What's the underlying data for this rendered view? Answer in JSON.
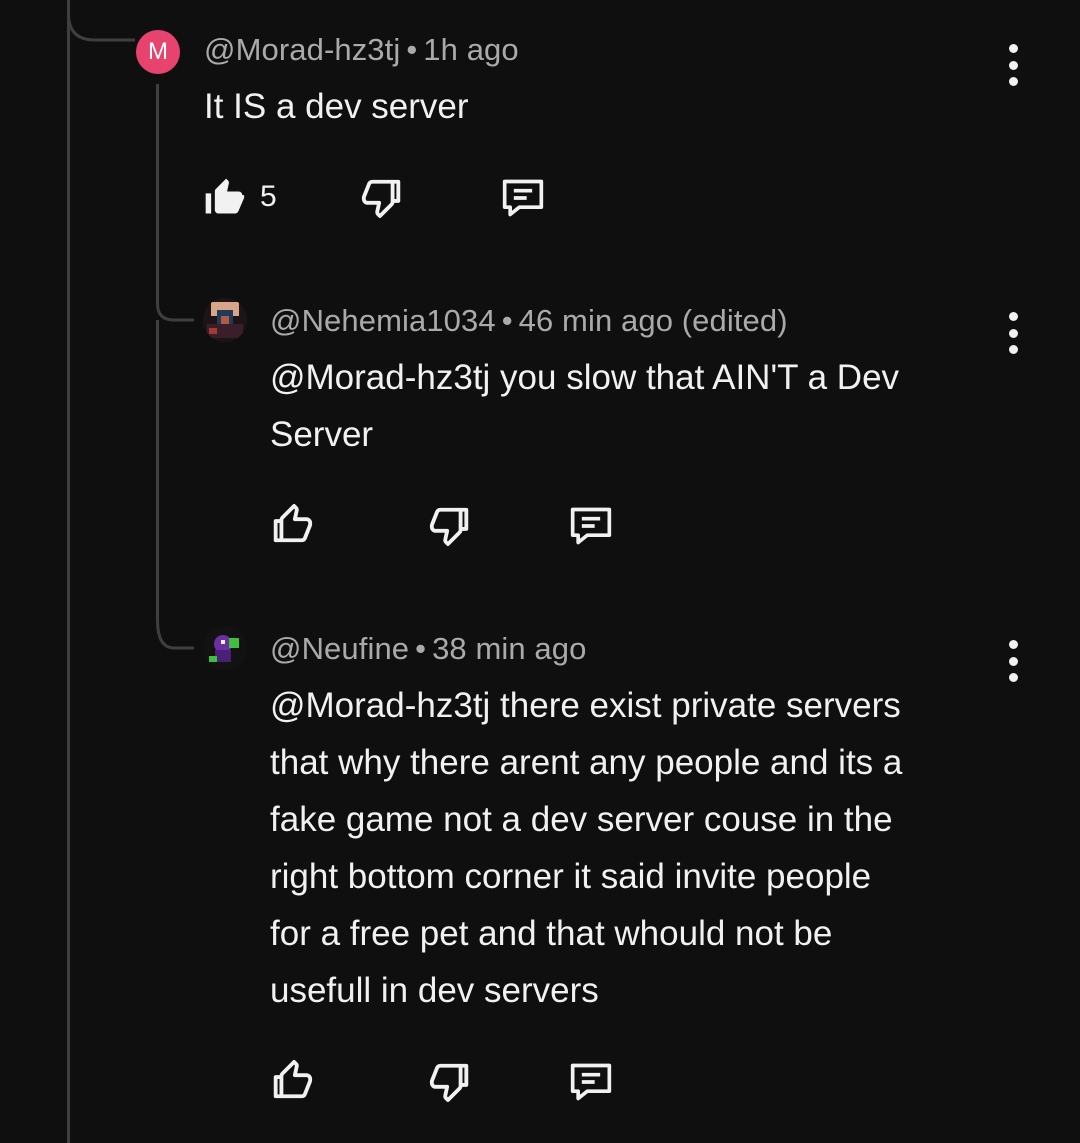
{
  "comments": [
    {
      "avatar_letter": "M",
      "author": "@Morad-hz3tj",
      "separator": "•",
      "time": "1h ago",
      "text": "It IS a dev server",
      "likes": "5"
    },
    {
      "author": "@Nehemia1034",
      "separator": "•",
      "time": "46 min ago (edited)",
      "text": "@Morad-hz3tj you slow that AIN'T a Dev\nServer"
    },
    {
      "author": "@Neufine",
      "separator": "•",
      "time": "38 min ago",
      "text": "@Morad-hz3tj there exist private servers\nthat why there arent any people and its a\nfake game not a dev server couse in the\nright bottom corner it said invite people\nfor a free pet and that whould not be\nusefull in dev servers"
    }
  ],
  "icons": {
    "like": "thumbs-up-icon",
    "dislike": "thumbs-down-icon",
    "reply": "reply-comment-icon",
    "more": "more-vertical-icon"
  },
  "colors": {
    "background": "#0f0f0f",
    "text": "#f1f1f1",
    "meta": "#aaaaaa",
    "avatar_m": "#e8426e",
    "thread_line": "#3f3f3f"
  }
}
